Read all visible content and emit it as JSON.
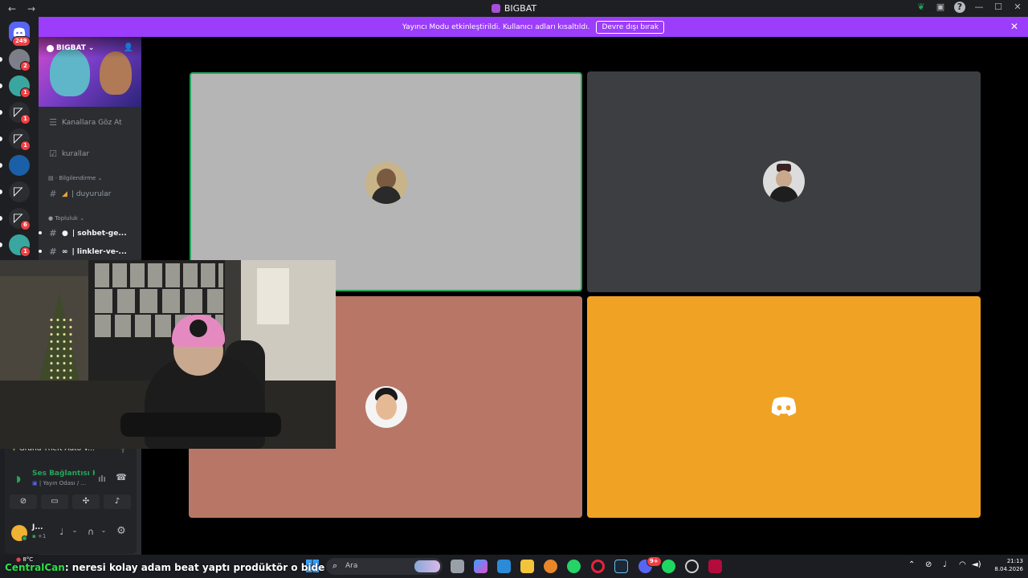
{
  "window": {
    "back_glyph": "←",
    "forward_glyph": "→",
    "title": "BIGBAT",
    "icons": [
      "leaf-icon",
      "inbox-icon",
      "help-icon"
    ],
    "minimize_glyph": "—",
    "maximize_glyph": "☐",
    "close_glyph": "✕"
  },
  "banner": {
    "message": "Yayıncı Modu etkinleştirildi. Kullanıcı adları kısaltıldı.",
    "button_label": "Devre dışı bırak",
    "close_glyph": "✕",
    "color": "#9b3dfa"
  },
  "rail": {
    "home_badge": "249",
    "servers": [
      {
        "badge": "2",
        "color": "#7c7f88"
      },
      {
        "badge": "1",
        "color": "#3aa6a0"
      },
      {
        "badge": "1",
        "color": "#ffffff"
      },
      {
        "badge": "1",
        "color": "#ffffff"
      },
      {
        "badge": "",
        "color": "#1b5fa8"
      },
      {
        "badge": "",
        "color": "#ffffff"
      },
      {
        "badge": "6",
        "color": "#ffffff"
      },
      {
        "badge": "1",
        "color": "#3aa6a0"
      }
    ]
  },
  "sidebar": {
    "server_name": "BIGBAT",
    "browse_channels": "Kanallara Göz At",
    "rules": "kurallar",
    "cat_info": "Bilgilendirme",
    "announcements": "| duyurular",
    "cat_community": "Topluluk",
    "chat": "| sohbet-ge...",
    "links": "| linkler-ve-..."
  },
  "voice_panel": {
    "activity": "Grand Theft Auto V...",
    "status": "Ses Bağlantısı K",
    "channel": "| Yayın Odası / ...",
    "user_name": "J...",
    "user_sub": "+1",
    "status_color": "#23a55a"
  },
  "stage": {
    "tiles": [
      {
        "bg": "#b5b5b5",
        "speaking": true
      },
      {
        "bg": "#3d3e42",
        "speaking": false
      },
      {
        "bg": "#b87766",
        "speaking": false
      },
      {
        "bg": "#f0a224",
        "speaking": false
      }
    ]
  },
  "taskbar": {
    "weather": "8°C",
    "search_placeholder": "Ara",
    "time": "21:13",
    "date": "8.04.2026",
    "discord_badge": "9+"
  },
  "stream_overlay": {
    "user": "CentralCan",
    "message": ": neresi kolay adam beat yaptı prodüktör o bide"
  }
}
